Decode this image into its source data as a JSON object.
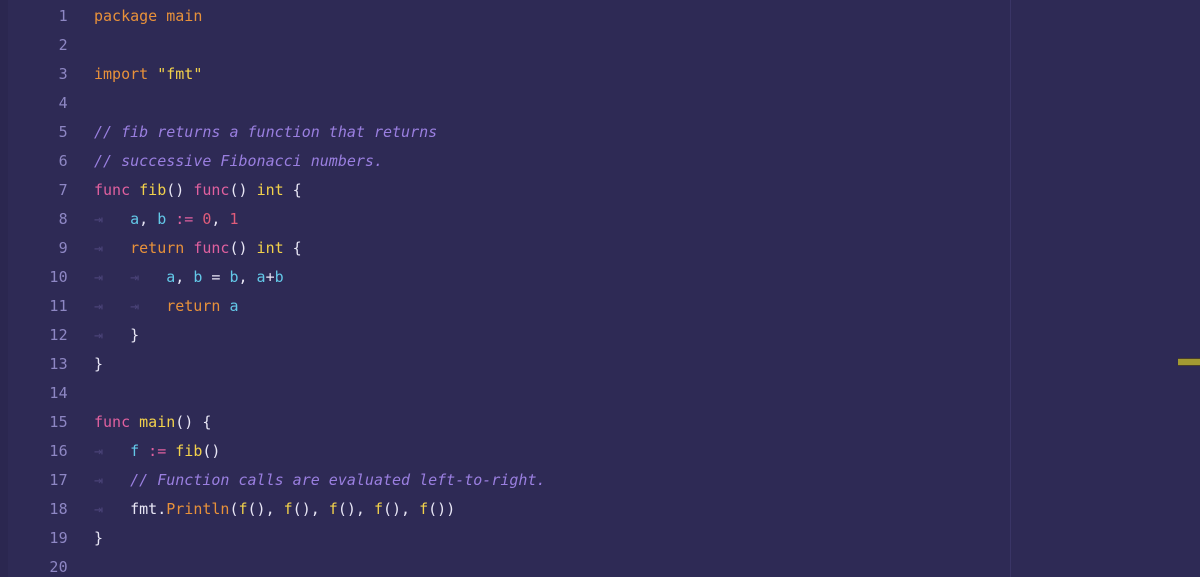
{
  "editor": {
    "language": "go",
    "colors": {
      "background": "#2e2a55",
      "gutter_text": "#8e87c4",
      "keyword": "#e8913a",
      "func_keyword": "#e0609f",
      "identifier": "#f2d14b",
      "string": "#f2d14b",
      "variable": "#63c8e8",
      "operator": "#e0609f",
      "number": "#e05c7a",
      "plain": "#e8e6f5",
      "comment": "#9a7fe0",
      "divider": "#3a3566",
      "scroll_marker": "#a39a32"
    },
    "indent_guide_glyph": "⇥",
    "line_numbers": [
      "1",
      "2",
      "3",
      "4",
      "5",
      "6",
      "7",
      "8",
      "9",
      "10",
      "11",
      "12",
      "13",
      "14",
      "15",
      "16",
      "17",
      "18",
      "19",
      "20"
    ],
    "lines": [
      {
        "number": "1",
        "indent": 0,
        "tokens": [
          {
            "text": "package",
            "type": "kw"
          },
          {
            "text": " ",
            "type": "plain"
          },
          {
            "text": "main",
            "type": "kw"
          }
        ]
      },
      {
        "number": "2",
        "indent": 0,
        "tokens": []
      },
      {
        "number": "3",
        "indent": 0,
        "tokens": [
          {
            "text": "import",
            "type": "kw"
          },
          {
            "text": " ",
            "type": "plain"
          },
          {
            "text": "\"fmt\"",
            "type": "str"
          }
        ]
      },
      {
        "number": "4",
        "indent": 0,
        "tokens": []
      },
      {
        "number": "5",
        "indent": 0,
        "tokens": [
          {
            "text": "// fib returns a function that returns",
            "type": "comment"
          }
        ]
      },
      {
        "number": "6",
        "indent": 0,
        "tokens": [
          {
            "text": "// successive Fibonacci numbers.",
            "type": "comment"
          }
        ]
      },
      {
        "number": "7",
        "indent": 0,
        "tokens": [
          {
            "text": "func",
            "type": "func"
          },
          {
            "text": " ",
            "type": "plain"
          },
          {
            "text": "fib",
            "type": "ident"
          },
          {
            "text": "() ",
            "type": "plain"
          },
          {
            "text": "func",
            "type": "func"
          },
          {
            "text": "() ",
            "type": "plain"
          },
          {
            "text": "int",
            "type": "ident"
          },
          {
            "text": " {",
            "type": "plain"
          }
        ]
      },
      {
        "number": "8",
        "indent": 1,
        "tokens": [
          {
            "text": "a",
            "type": "var"
          },
          {
            "text": ", ",
            "type": "plain"
          },
          {
            "text": "b",
            "type": "var"
          },
          {
            "text": " ",
            "type": "plain"
          },
          {
            "text": ":=",
            "type": "op"
          },
          {
            "text": " ",
            "type": "plain"
          },
          {
            "text": "0",
            "type": "num"
          },
          {
            "text": ", ",
            "type": "plain"
          },
          {
            "text": "1",
            "type": "num"
          }
        ]
      },
      {
        "number": "9",
        "indent": 1,
        "tokens": [
          {
            "text": "return",
            "type": "kw"
          },
          {
            "text": " ",
            "type": "plain"
          },
          {
            "text": "func",
            "type": "func"
          },
          {
            "text": "() ",
            "type": "plain"
          },
          {
            "text": "int",
            "type": "ident"
          },
          {
            "text": " {",
            "type": "plain"
          }
        ]
      },
      {
        "number": "10",
        "indent": 2,
        "tokens": [
          {
            "text": "a",
            "type": "var"
          },
          {
            "text": ", ",
            "type": "plain"
          },
          {
            "text": "b",
            "type": "var"
          },
          {
            "text": " = ",
            "type": "plain"
          },
          {
            "text": "b",
            "type": "var"
          },
          {
            "text": ", ",
            "type": "plain"
          },
          {
            "text": "a",
            "type": "var"
          },
          {
            "text": "+",
            "type": "plain"
          },
          {
            "text": "b",
            "type": "var"
          }
        ]
      },
      {
        "number": "11",
        "indent": 2,
        "tokens": [
          {
            "text": "return",
            "type": "kw"
          },
          {
            "text": " ",
            "type": "plain"
          },
          {
            "text": "a",
            "type": "var"
          }
        ]
      },
      {
        "number": "12",
        "indent": 1,
        "tokens": [
          {
            "text": "}",
            "type": "plain"
          }
        ]
      },
      {
        "number": "13",
        "indent": 0,
        "tokens": [
          {
            "text": "}",
            "type": "plain"
          }
        ]
      },
      {
        "number": "14",
        "indent": 0,
        "tokens": []
      },
      {
        "number": "15",
        "indent": 0,
        "tokens": [
          {
            "text": "func",
            "type": "func"
          },
          {
            "text": " ",
            "type": "plain"
          },
          {
            "text": "main",
            "type": "ident"
          },
          {
            "text": "() {",
            "type": "plain"
          }
        ]
      },
      {
        "number": "16",
        "indent": 1,
        "tokens": [
          {
            "text": "f",
            "type": "var"
          },
          {
            "text": " ",
            "type": "plain"
          },
          {
            "text": ":=",
            "type": "op"
          },
          {
            "text": " ",
            "type": "plain"
          },
          {
            "text": "fib",
            "type": "ident"
          },
          {
            "text": "()",
            "type": "plain"
          }
        ]
      },
      {
        "number": "17",
        "indent": 1,
        "tokens": [
          {
            "text": "// Function calls are evaluated left-to-right.",
            "type": "comment"
          }
        ]
      },
      {
        "number": "18",
        "indent": 1,
        "tokens": [
          {
            "text": "fmt",
            "type": "plain"
          },
          {
            "text": ".",
            "type": "plain"
          },
          {
            "text": "Println",
            "type": "method"
          },
          {
            "text": "(",
            "type": "plain"
          },
          {
            "text": "f",
            "type": "ident"
          },
          {
            "text": "(), ",
            "type": "plain"
          },
          {
            "text": "f",
            "type": "ident"
          },
          {
            "text": "(), ",
            "type": "plain"
          },
          {
            "text": "f",
            "type": "ident"
          },
          {
            "text": "(), ",
            "type": "plain"
          },
          {
            "text": "f",
            "type": "ident"
          },
          {
            "text": "(), ",
            "type": "plain"
          },
          {
            "text": "f",
            "type": "ident"
          },
          {
            "text": "())",
            "type": "plain"
          }
        ]
      },
      {
        "number": "19",
        "indent": 0,
        "tokens": [
          {
            "text": "}",
            "type": "plain"
          }
        ]
      },
      {
        "number": "20",
        "indent": 0,
        "tokens": []
      }
    ]
  }
}
